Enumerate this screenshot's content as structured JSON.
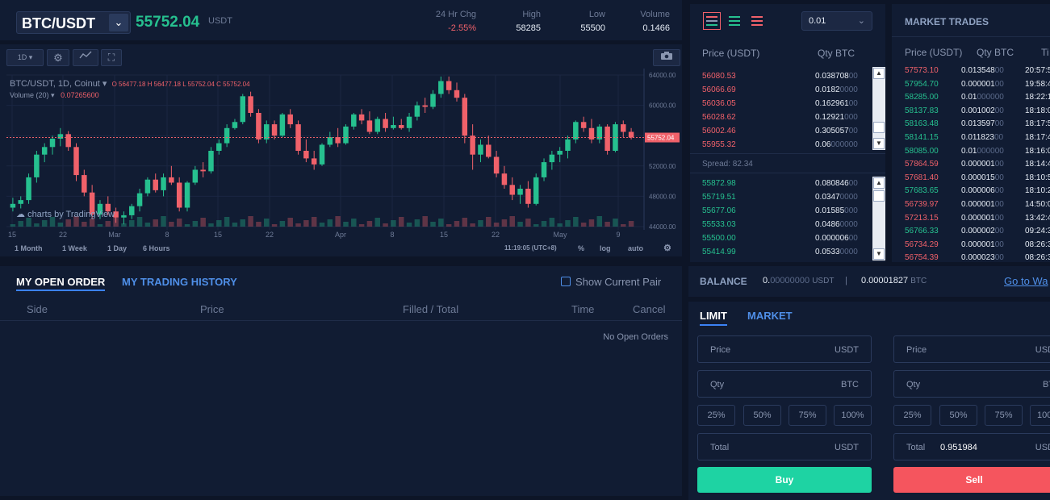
{
  "ticker": {
    "pair": "BTC/USDT",
    "price": "55752.04",
    "unit": "USDT",
    "stats": [
      {
        "label": "24 Hr Chg",
        "value": "-2.55%"
      },
      {
        "label": "High",
        "value": "58285"
      },
      {
        "label": "Low",
        "value": "55500"
      },
      {
        "label": "Volume",
        "value": "0.1466"
      }
    ]
  },
  "chart": {
    "interval_btn": "1D",
    "legend_title": "BTC/USDT, 1D, Coinut",
    "ohlc": "O 56477.18  H 56477.18  L 55752.04  C 55752.04",
    "volume_label": "Volume (20)",
    "volume_value": "0.07265600",
    "watermark": "charts by TradingView",
    "price_ticks": [
      "64000.00",
      "60000.00",
      "56000.00",
      "52000.00",
      "48000.00",
      "44000.00"
    ],
    "last_price_tag": "55752.04",
    "date_ticks": [
      "15",
      "22",
      "Mar",
      "8",
      "15",
      "22",
      "Apr",
      "8",
      "15",
      "22",
      "May",
      "9"
    ],
    "timeframes": [
      "1 Month",
      "1 Week",
      "1 Day",
      "6 Hours"
    ],
    "time_readout": "11:19:05 (UTC+8)",
    "options": [
      "%",
      "log",
      "auto"
    ]
  },
  "chart_data": {
    "type": "candlestick",
    "ylim": [
      44000,
      64000
    ],
    "candles": [
      [
        46500,
        47800,
        46000,
        47000
      ],
      [
        47000,
        48000,
        46400,
        47500
      ],
      [
        47500,
        51000,
        47000,
        50500
      ],
      [
        50500,
        54000,
        49800,
        53500
      ],
      [
        53500,
        55000,
        52500,
        54500
      ],
      [
        54500,
        56000,
        53500,
        55600
      ],
      [
        55600,
        57000,
        54600,
        56200
      ],
      [
        56200,
        56600,
        54000,
        54500
      ],
      [
        54500,
        55000,
        50000,
        50800
      ],
      [
        50800,
        51500,
        48000,
        48500
      ],
      [
        48500,
        49500,
        45000,
        45600
      ],
      [
        45600,
        47500,
        45000,
        47000
      ],
      [
        47000,
        48000,
        45500,
        46000
      ],
      [
        46000,
        46500,
        44500,
        45200
      ],
      [
        45200,
        46000,
        44300,
        45500
      ],
      [
        45500,
        47000,
        45000,
        46700
      ],
      [
        46700,
        49000,
        46000,
        48400
      ],
      [
        48400,
        50500,
        48000,
        50200
      ],
      [
        50200,
        51000,
        48500,
        48800
      ],
      [
        48800,
        51000,
        48000,
        50500
      ],
      [
        50500,
        52000,
        49500,
        49800
      ],
      [
        49800,
        50500,
        46000,
        46500
      ],
      [
        46500,
        50000,
        46000,
        49800
      ],
      [
        49800,
        52000,
        49500,
        51500
      ],
      [
        51500,
        52500,
        50500,
        51300
      ],
      [
        51300,
        54500,
        51000,
        54000
      ],
      [
        54000,
        55500,
        53500,
        55000
      ],
      [
        55000,
        57500,
        54500,
        57000
      ],
      [
        57000,
        58200,
        56800,
        57800
      ],
      [
        57800,
        61500,
        57500,
        61200
      ],
      [
        61200,
        61800,
        58500,
        59000
      ],
      [
        59000,
        59500,
        55000,
        55500
      ],
      [
        55500,
        58000,
        55000,
        57500
      ],
      [
        57500,
        58000,
        55500,
        56000
      ],
      [
        56000,
        59000,
        55800,
        58800
      ],
      [
        58800,
        59500,
        57000,
        57500
      ],
      [
        57500,
        58000,
        53500,
        54000
      ],
      [
        54000,
        55500,
        52500,
        53000
      ],
      [
        53000,
        54000,
        51500,
        52200
      ],
      [
        52200,
        55000,
        52000,
        54800
      ],
      [
        54800,
        56500,
        54500,
        55800
      ],
      [
        55800,
        57000,
        54500,
        55000
      ],
      [
        55000,
        57500,
        54800,
        57200
      ],
      [
        57200,
        59000,
        56800,
        58800
      ],
      [
        58800,
        59500,
        57500,
        58000
      ],
      [
        58000,
        59200,
        56200,
        56500
      ],
      [
        56500,
        58500,
        56200,
        58200
      ],
      [
        58200,
        59000,
        56500,
        57000
      ],
      [
        57000,
        58500,
        56800,
        57400
      ],
      [
        57400,
        58200,
        56800,
        57000
      ],
      [
        57000,
        59000,
        56500,
        58500
      ],
      [
        58500,
        60500,
        58000,
        60000
      ],
      [
        60000,
        61000,
        59000,
        59800
      ],
      [
        59800,
        62000,
        59500,
        61500
      ],
      [
        61500,
        63800,
        61000,
        63200
      ],
      [
        63200,
        63800,
        61500,
        62000
      ],
      [
        62000,
        63000,
        60500,
        61000
      ],
      [
        61000,
        61500,
        55000,
        56000
      ],
      [
        56000,
        57500,
        51500,
        53500
      ],
      [
        53500,
        55500,
        52500,
        54800
      ],
      [
        54800,
        56000,
        53000,
        53200
      ],
      [
        53200,
        54000,
        50500,
        51000
      ],
      [
        51000,
        52000,
        49000,
        49500
      ],
      [
        49500,
        50500,
        47500,
        48200
      ],
      [
        48200,
        49500,
        47000,
        49000
      ],
      [
        49000,
        50000,
        46500,
        47000
      ],
      [
        47000,
        51000,
        46800,
        50500
      ],
      [
        50500,
        53000,
        50000,
        52500
      ],
      [
        52500,
        54000,
        51500,
        53500
      ],
      [
        53500,
        54500,
        52500,
        54000
      ],
      [
        54000,
        56000,
        53000,
        55500
      ],
      [
        55500,
        58000,
        55000,
        57800
      ],
      [
        57800,
        58500,
        56500,
        57000
      ],
      [
        57000,
        58200,
        55000,
        55500
      ],
      [
        55500,
        57500,
        55000,
        57200
      ],
      [
        57200,
        57500,
        53500,
        54000
      ],
      [
        54000,
        57800,
        53800,
        57500
      ],
      [
        57500,
        58000,
        55800,
        56500
      ],
      [
        56500,
        57000,
        55500,
        55752
      ]
    ],
    "volume_series": []
  },
  "orderbook": {
    "headers": [
      "Price (USDT)",
      "Qty BTC"
    ],
    "asks": [
      {
        "price": "56080.53",
        "qty": "0.038708",
        "qty_tail": "00"
      },
      {
        "price": "56066.69",
        "qty": "0.0182",
        "qty_tail": "0000"
      },
      {
        "price": "56036.05",
        "qty": "0.162961",
        "qty_tail": "00"
      },
      {
        "price": "56028.62",
        "qty": "0.12921",
        "qty_tail": "000"
      },
      {
        "price": "56002.46",
        "qty": "0.305057",
        "qty_tail": "00"
      },
      {
        "price": "55955.32",
        "qty": "0.06",
        "qty_tail": "000000"
      }
    ],
    "spread": "Spread: 82.34",
    "bids": [
      {
        "price": "55872.98",
        "qty": "0.080846",
        "qty_tail": "00"
      },
      {
        "price": "55719.51",
        "qty": "0.0347",
        "qty_tail": "0000"
      },
      {
        "price": "55677.06",
        "qty": "0.01585",
        "qty_tail": "000"
      },
      {
        "price": "55533.03",
        "qty": "0.0486",
        "qty_tail": "0000"
      },
      {
        "price": "55500.00",
        "qty": "0.000006",
        "qty_tail": "00"
      },
      {
        "price": "55414.99",
        "qty": "0.0533",
        "qty_tail": "0000"
      }
    ],
    "precision": "0.01"
  },
  "market_trades": {
    "title": "MARKET TRADES",
    "headers": [
      "Price (USDT)",
      "Qty BTC",
      "Ti"
    ],
    "rows": [
      {
        "price": "57573.10",
        "side": "sell",
        "qty": "0.013548",
        "qty_tail": "00",
        "time": "20:57:5"
      },
      {
        "price": "57954.70",
        "side": "buy",
        "qty": "0.000001",
        "qty_tail": "00",
        "time": "19:58:4"
      },
      {
        "price": "58285.00",
        "side": "buy",
        "qty": "0.01",
        "qty_tail": "000000",
        "time": "18:22:1"
      },
      {
        "price": "58137.83",
        "side": "buy",
        "qty": "0.001002",
        "qty_tail": "00",
        "time": "18:18:0"
      },
      {
        "price": "58163.48",
        "side": "buy",
        "qty": "0.013597",
        "qty_tail": "00",
        "time": "18:17:5"
      },
      {
        "price": "58141.15",
        "side": "buy",
        "qty": "0.011823",
        "qty_tail": "00",
        "time": "18:17:4"
      },
      {
        "price": "58085.00",
        "side": "buy",
        "qty": "0.01",
        "qty_tail": "000000",
        "time": "18:16:0"
      },
      {
        "price": "57864.59",
        "side": "sell",
        "qty": "0.000001",
        "qty_tail": "00",
        "time": "18:14:4"
      },
      {
        "price": "57681.40",
        "side": "sell",
        "qty": "0.000015",
        "qty_tail": "00",
        "time": "18:10:5"
      },
      {
        "price": "57683.65",
        "side": "buy",
        "qty": "0.000006",
        "qty_tail": "00",
        "time": "18:10:2"
      },
      {
        "price": "56739.97",
        "side": "sell",
        "qty": "0.000001",
        "qty_tail": "00",
        "time": "14:50:0"
      },
      {
        "price": "57213.15",
        "side": "sell",
        "qty": "0.000001",
        "qty_tail": "00",
        "time": "13:42:4"
      },
      {
        "price": "56766.33",
        "side": "buy",
        "qty": "0.000002",
        "qty_tail": "00",
        "time": "09:24:3"
      },
      {
        "price": "56734.29",
        "side": "sell",
        "qty": "0.000001",
        "qty_tail": "00",
        "time": "08:26:3"
      },
      {
        "price": "56754.39",
        "side": "sell",
        "qty": "0.000023",
        "qty_tail": "00",
        "time": "08:26:3"
      }
    ]
  },
  "orders": {
    "tab_open": "MY OPEN ORDER",
    "tab_history": "MY TRADING HISTORY",
    "show_current_pair": "Show Current Pair",
    "columns": [
      "Side",
      "Price",
      "Filled / Total",
      "Time",
      "Cancel"
    ],
    "empty": "No Open Orders"
  },
  "balance": {
    "label": "BALANCE",
    "usdt_value": "0.",
    "usdt_tail": "00000000",
    "usdt_unit": "USDT",
    "sep": "|",
    "btc_value": "0.00001827",
    "btc_unit": "BTC",
    "link": "Go to Wa"
  },
  "trade": {
    "tab_limit": "LIMIT",
    "tab_market": "MARKET",
    "buy": {
      "price_label": "Price",
      "price_unit": "USDT",
      "qty_label": "Qty",
      "qty_unit": "BTC",
      "pcts": [
        "25%",
        "50%",
        "75%",
        "100%"
      ],
      "total_label": "Total",
      "total_value": "",
      "total_unit": "USDT",
      "button": "Buy"
    },
    "sell": {
      "price_label": "Price",
      "price_unit": "USD",
      "qty_label": "Qty",
      "qty_unit": "BT",
      "pcts": [
        "25%",
        "50%",
        "75%",
        "100"
      ],
      "total_label": "Total",
      "total_value": "0.951984",
      "total_unit": "USD",
      "button": "Sell"
    }
  },
  "colors": {
    "up": "#26c08f",
    "down": "#f0616a",
    "buy_button": "#1ed3a3",
    "sell_button": "#f5555e"
  }
}
